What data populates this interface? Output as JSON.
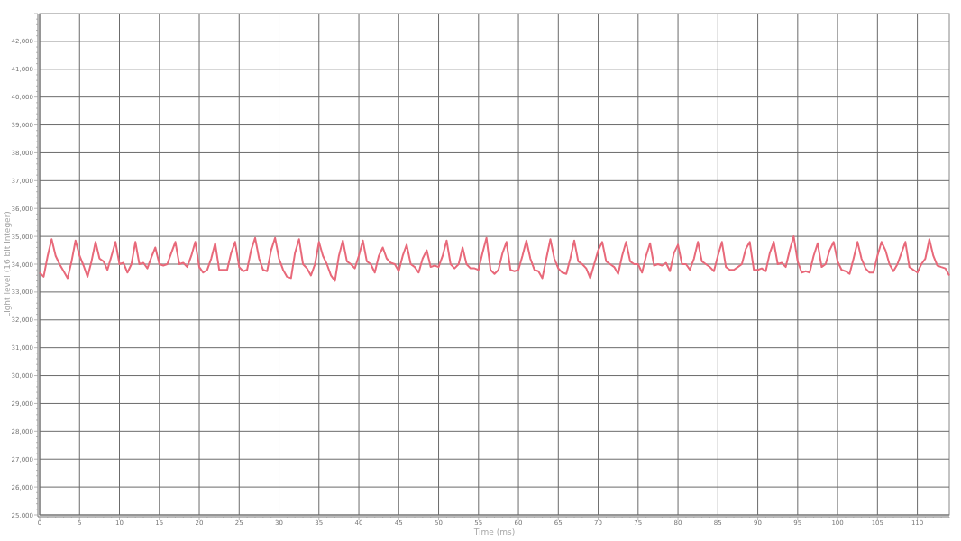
{
  "chart": {
    "chart_data": {
      "type": "line",
      "xlabel": "Time (ms)",
      "ylabel": "Light level (16 bit integer)",
      "xlim": [
        0,
        114
      ],
      "ylim": [
        25000,
        43000
      ],
      "xticks": [
        0,
        5,
        10,
        15,
        20,
        25,
        30,
        35,
        40,
        45,
        50,
        55,
        60,
        65,
        70,
        75,
        80,
        85,
        90,
        95,
        100,
        105,
        110
      ],
      "yticks": [
        {
          "value": 25000,
          "label": "25,000"
        },
        {
          "value": 26000,
          "label": "26,000"
        },
        {
          "value": 27000,
          "label": "27,000"
        },
        {
          "value": 28000,
          "label": "28,000"
        },
        {
          "value": 29000,
          "label": "29,000"
        },
        {
          "value": 30000,
          "label": "30,000"
        },
        {
          "value": 31000,
          "label": "31,000"
        },
        {
          "value": 32000,
          "label": "32,000"
        },
        {
          "value": 33000,
          "label": "33,000"
        },
        {
          "value": 34000,
          "label": "34,000"
        },
        {
          "value": 35000,
          "label": "35,000"
        },
        {
          "value": 36000,
          "label": "36,000"
        },
        {
          "value": 37000,
          "label": "37,000"
        },
        {
          "value": 38000,
          "label": "38,000"
        },
        {
          "value": 39000,
          "label": "39,000"
        },
        {
          "value": 40000,
          "label": "40,000"
        },
        {
          "value": 41000,
          "label": "41,000"
        },
        {
          "value": 42000,
          "label": "42,000"
        }
      ],
      "x": [
        0,
        0.5,
        1,
        1.5,
        2,
        2.5,
        3,
        3.5,
        4,
        4.5,
        5,
        5.5,
        6,
        6.5,
        7,
        7.5,
        8,
        8.5,
        9,
        9.5,
        10,
        10.5,
        11,
        11.5,
        12,
        12.5,
        13,
        13.5,
        14,
        14.5,
        15,
        15.5,
        16,
        16.5,
        17,
        17.5,
        18,
        18.5,
        19,
        19.5,
        20,
        20.5,
        21,
        21.5,
        22,
        22.5,
        23,
        23.5,
        24,
        24.5,
        25,
        25.5,
        26,
        26.5,
        27,
        27.5,
        28,
        28.5,
        29,
        29.5,
        30,
        30.5,
        31,
        31.5,
        32,
        32.5,
        33,
        33.5,
        34,
        34.5,
        35,
        35.5,
        36,
        36.5,
        37,
        37.5,
        38,
        38.5,
        39,
        39.5,
        40,
        40.5,
        41,
        41.5,
        42,
        42.5,
        43,
        43.5,
        44,
        44.5,
        45,
        45.5,
        46,
        46.5,
        47,
        47.5,
        48,
        48.5,
        49,
        49.5,
        50,
        50.5,
        51,
        51.5,
        52,
        52.5,
        53,
        53.5,
        54,
        54.5,
        55,
        55.5,
        56,
        56.5,
        57,
        57.5,
        58,
        58.5,
        59,
        59.5,
        60,
        60.5,
        61,
        61.5,
        62,
        62.5,
        63,
        63.5,
        64,
        64.5,
        65,
        65.5,
        66,
        66.5,
        67,
        67.5,
        68,
        68.5,
        69,
        69.5,
        70,
        70.5,
        71,
        71.5,
        72,
        72.5,
        73,
        73.5,
        74,
        74.5,
        75,
        75.5,
        76,
        76.5,
        77,
        77.5,
        78,
        78.5,
        79,
        79.5,
        80,
        80.5,
        81,
        81.5,
        82,
        82.5,
        83,
        83.5,
        84,
        84.5,
        85,
        85.5,
        86,
        86.5,
        87,
        87.5,
        88,
        88.5,
        89,
        89.5,
        90,
        90.5,
        91,
        91.5,
        92,
        92.5,
        93,
        93.5,
        94,
        94.5,
        95,
        95.5,
        96,
        96.5,
        97,
        97.5,
        98,
        98.5,
        99,
        99.5,
        100,
        100.5,
        101,
        101.5,
        102,
        102.5,
        103,
        103.5,
        104,
        104.5,
        105,
        105.5,
        106,
        106.5,
        107,
        107.5,
        108,
        108.5,
        109,
        109.5,
        110,
        110.5,
        111,
        111.5,
        112,
        112.5,
        113,
        113.5,
        114
      ],
      "grid": true,
      "series": [
        {
          "color": "#e8697a",
          "values": [
            33700,
            33550,
            34300,
            34900,
            34300,
            34000,
            33750,
            33500,
            34100,
            34850,
            34300,
            33950,
            33550,
            34100,
            34800,
            34200,
            34100,
            33800,
            34300,
            34800,
            34000,
            34050,
            33700,
            34000,
            34800,
            34000,
            34050,
            33850,
            34250,
            34600,
            34000,
            33950,
            34000,
            34400,
            34800,
            34000,
            34050,
            33900,
            34300,
            34800,
            33900,
            33700,
            33800,
            34200,
            34750,
            33800,
            33800,
            33800,
            34400,
            34800,
            33900,
            33750,
            33800,
            34500,
            34950,
            34200,
            33800,
            33750,
            34500,
            34950,
            34200,
            33800,
            33550,
            33500,
            34400,
            34900,
            34000,
            33850,
            33600,
            34000,
            34800,
            34300,
            34000,
            33600,
            33400,
            34300,
            34850,
            34100,
            34000,
            33850,
            34300,
            34850,
            34100,
            34000,
            33700,
            34300,
            34600,
            34200,
            34050,
            34000,
            33750,
            34300,
            34700,
            34000,
            33900,
            33700,
            34200,
            34500,
            33900,
            33950,
            33900,
            34300,
            34850,
            34000,
            33850,
            34000,
            34600,
            34000,
            33850,
            33850,
            33800,
            34400,
            34950,
            33800,
            33650,
            33800,
            34400,
            34800,
            33800,
            33750,
            33800,
            34300,
            34850,
            34200,
            33800,
            33750,
            33500,
            34200,
            34900,
            34200,
            33850,
            33700,
            33650,
            34200,
            34850,
            34100,
            34000,
            33850,
            33500,
            34000,
            34500,
            34800,
            34100,
            34000,
            33900,
            33650,
            34300,
            34800,
            34100,
            34000,
            34000,
            33700,
            34300,
            34750,
            33950,
            34000,
            33950,
            34050,
            33750,
            34400,
            34700,
            34000,
            34000,
            33800,
            34200,
            34800,
            34100,
            34000,
            33900,
            33750,
            34300,
            34800,
            33900,
            33800,
            33800,
            33900,
            34000,
            34550,
            34800,
            33800,
            33800,
            33850,
            33750,
            34400,
            34800,
            34000,
            34050,
            33900,
            34500,
            35000,
            34100,
            33700,
            33750,
            33700,
            34300,
            34750,
            33900,
            34000,
            34500,
            34800,
            34100,
            33800,
            33750,
            33650,
            34200,
            34800,
            34200,
            33850,
            33700,
            33700,
            34300,
            34800,
            34500,
            34000,
            33750,
            34000,
            34400,
            34800,
            33900,
            33800,
            33700,
            34000,
            34200,
            34900,
            34300,
            33950,
            33900,
            33850,
            33600
          ]
        }
      ]
    }
  }
}
